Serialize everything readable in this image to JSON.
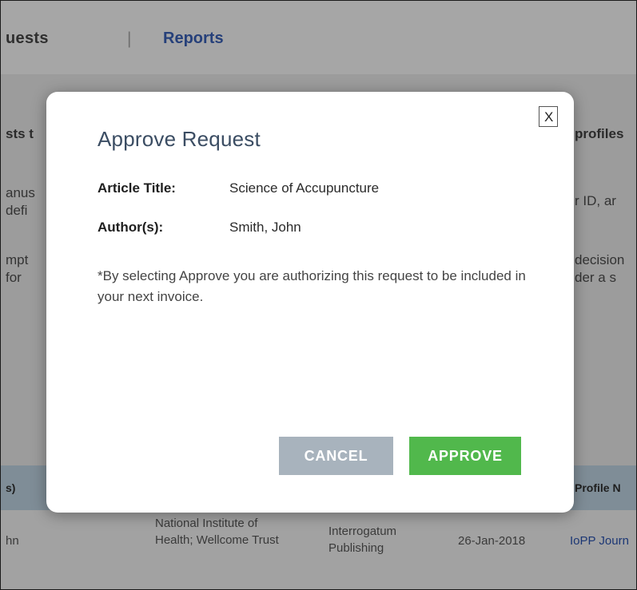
{
  "nav": {
    "requests_tab": "uests",
    "separator": "|",
    "reports_tab": "Reports"
  },
  "background": {
    "left_heading": "sts t",
    "left_line_1": "anus",
    "left_line_2": "defi",
    "left_line_3": "mpt",
    "left_line_4": "for",
    "right_heading": "profiles",
    "right_line_1": "r ID, ar",
    "right_line_2": "decision",
    "right_line_3": "der a s"
  },
  "table": {
    "header_left": "s)",
    "header_right": "Profile N",
    "row": {
      "author": "hn",
      "funder": "National Institute of Health; Wellcome Trust",
      "publisher": "Interrogatum Publishing",
      "date": "26-Jan-2018",
      "profile": "IoPP Journ"
    }
  },
  "modal": {
    "close_label": "X",
    "title": "Approve Request",
    "article_title_label": "Article Title:",
    "article_title_value": "Science of Accupuncture",
    "authors_label": "Author(s):",
    "authors_value": "Smith, John",
    "notice": "*By selecting Approve you are authorizing this request to be included in your next invoice.",
    "cancel_label": "CANCEL",
    "approve_label": "APPROVE"
  },
  "colors": {
    "approve_button": "#51b84c",
    "cancel_button": "#a8b3bd",
    "title_text": "#3b4d63",
    "reports_tab": "#26407a"
  }
}
